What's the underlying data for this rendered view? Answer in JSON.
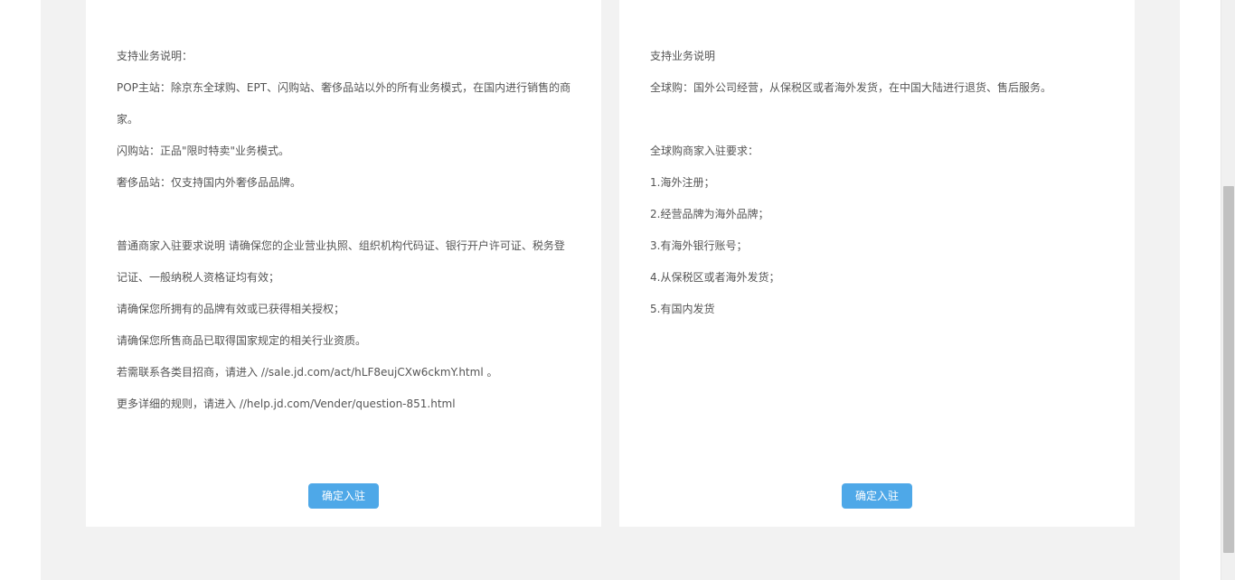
{
  "left_panel": {
    "lines": [
      "支持业务说明：",
      "POP主站：除京东全球购、EPT、闪购站、奢侈品站以外的所有业务模式，在国内进行销售的商家。",
      "闪购站：正品\"限时特卖\"业务模式。",
      "奢侈品站：仅支持国内外奢侈品品牌。",
      "",
      "普通商家入驻要求说明 请确保您的企业营业执照、组织机构代码证、银行开户许可证、税务登记证、一般纳税人资格证均有效；",
      "请确保您所拥有的品牌有效或已获得相关授权；",
      "请确保您所售商品已取得国家规定的相关行业资质。",
      "若需联系各类目招商，请进入 //sale.jd.com/act/hLF8eujCXw6ckmY.html 。",
      "更多详细的规则，请进入 //help.jd.com/Vender/question-851.html"
    ],
    "button_label": "确定入驻"
  },
  "right_panel": {
    "lines": [
      "支持业务说明",
      "全球购：国外公司经营，从保税区或者海外发货，在中国大陆进行退货、售后服务。",
      "",
      "全球购商家入驻要求：",
      "1.海外注册；",
      "2.经营品牌为海外品牌；",
      "3.有海外银行账号；",
      "4.从保税区或者海外发货；",
      "5.有国内发货"
    ],
    "button_label": "确定入驻"
  },
  "colors": {
    "page_background": "#f2f2f2",
    "panel_background": "#ffffff",
    "text": "#555555",
    "button": "#4ea8e8"
  }
}
